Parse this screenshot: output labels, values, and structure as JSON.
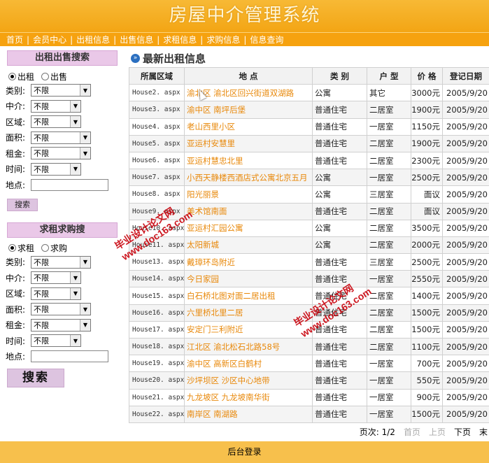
{
  "header": {
    "title": "房屋中介管理系统"
  },
  "nav": [
    "首页",
    "会员中心",
    "出租信息",
    "出售信息",
    "求租信息",
    "求购信息",
    "信息查询"
  ],
  "rent_search": {
    "title": "出租出售搜索",
    "radios": [
      {
        "label": "出租",
        "checked": true
      },
      {
        "label": "出售",
        "checked": false
      }
    ],
    "fields": [
      {
        "label": "类别:",
        "value": "不限"
      },
      {
        "label": "中介:",
        "value": "不限"
      },
      {
        "label": "区域:",
        "value": "不限"
      },
      {
        "label": "面积:",
        "value": "不限"
      },
      {
        "label": "租金:",
        "value": "不限"
      },
      {
        "label": "时间:",
        "value": "不限"
      }
    ],
    "location_label": "地点:",
    "button": "搜索"
  },
  "want_search": {
    "title": "求租求购搜",
    "radios": [
      {
        "label": "求租",
        "checked": true
      },
      {
        "label": "求购",
        "checked": false
      }
    ],
    "fields": [
      {
        "label": "类别:",
        "value": "不限"
      },
      {
        "label": "中介:",
        "value": "不限"
      },
      {
        "label": "区域:",
        "value": "不限"
      },
      {
        "label": "面积:",
        "value": "不限"
      },
      {
        "label": "租金:",
        "value": "不限"
      },
      {
        "label": "时间:",
        "value": "不限"
      }
    ],
    "location_label": "地点:",
    "button": "搜索"
  },
  "main": {
    "title": "最新出租信息",
    "columns": [
      "所属区域",
      "地 点",
      "类 别",
      "户 型",
      "价 格",
      "登记日期"
    ],
    "rows": [
      [
        "House2. aspx",
        "渝北区  渝北区回兴街道双湖路",
        "公寓",
        "其它",
        "3000元",
        "2005/9/20"
      ],
      [
        "House3. aspx",
        "渝中区  南坪后堡",
        "普通住宅",
        "二居室",
        "1900元",
        "2005/9/20"
      ],
      [
        "House4. aspx",
        "老山西里小区",
        "普通住宅",
        "一居室",
        "1150元",
        "2005/9/20"
      ],
      [
        "House5. aspx",
        "亚运村安慧里",
        "普通住宅",
        "二居室",
        "1900元",
        "2005/9/20"
      ],
      [
        "House6. aspx",
        "亚运村慧忠北里",
        "普通住宅",
        "二居室",
        "2300元",
        "2005/9/20"
      ],
      [
        "House7. aspx",
        "小西天静楼西酒店式公寓北京五月",
        "公寓",
        "一居室",
        "2500元",
        "2005/9/20"
      ],
      [
        "House8. aspx",
        "阳光丽景",
        "公寓",
        "三居室",
        "面议",
        "2005/9/20"
      ],
      [
        "House9. aspx",
        "美术馆南面",
        "普通住宅",
        "二居室",
        "面议",
        "2005/9/20"
      ],
      [
        "House10. aspx",
        "亚运村汇园公寓",
        "公寓",
        "二居室",
        "3500元",
        "2005/9/20"
      ],
      [
        "House11. aspx",
        "太阳新城",
        "公寓",
        "二居室",
        "2000元",
        "2005/9/20"
      ],
      [
        "House13. aspx",
        "戴璋环岛附近",
        "普通住宅",
        "三居室",
        "2500元",
        "2005/9/20"
      ],
      [
        "House14. aspx",
        "今日家园",
        "普通住宅",
        "一居室",
        "2550元",
        "2005/9/20"
      ],
      [
        "House15. aspx",
        "白石桥北图对面二居出租",
        "普通住宅",
        "二居室",
        "1400元",
        "2005/9/20"
      ],
      [
        "House16. aspx",
        "六里桥北里二居",
        "普通住宅",
        "二居室",
        "1500元",
        "2005/9/20"
      ],
      [
        "House17. aspx",
        "安定门三利附近",
        "普通住宅",
        "二居室",
        "1500元",
        "2005/9/20"
      ],
      [
        "House18. aspx",
        "江北区  渝北松石北路58号",
        "普通住宅",
        "二居室",
        "1100元",
        "2005/9/20"
      ],
      [
        "House19. aspx",
        "渝中区  高新区白鹤村",
        "普通住宅",
        "一居室",
        "700元",
        "2005/9/20"
      ],
      [
        "House20. aspx",
        "沙坪坝区  沙区中心地带",
        "普通住宅",
        "一居室",
        "550元",
        "2005/9/20"
      ],
      [
        "House21. aspx",
        "九龙坡区  九龙坡南华街",
        "普通住宅",
        "一居室",
        "900元",
        "2005/9/20"
      ],
      [
        "House22. aspx",
        "南岸区  南湖路",
        "普通住宅",
        "一居室",
        "1500元",
        "2005/9/20"
      ]
    ]
  },
  "pager": {
    "info": "页次: 1/2",
    "first": "首页",
    "prev": "上页",
    "next": "下页",
    "last": "末"
  },
  "footer": {
    "admin_login": "后台登录"
  },
  "watermark": {
    "line1": "毕业设计论文网",
    "line2": "www.doc163.com"
  }
}
